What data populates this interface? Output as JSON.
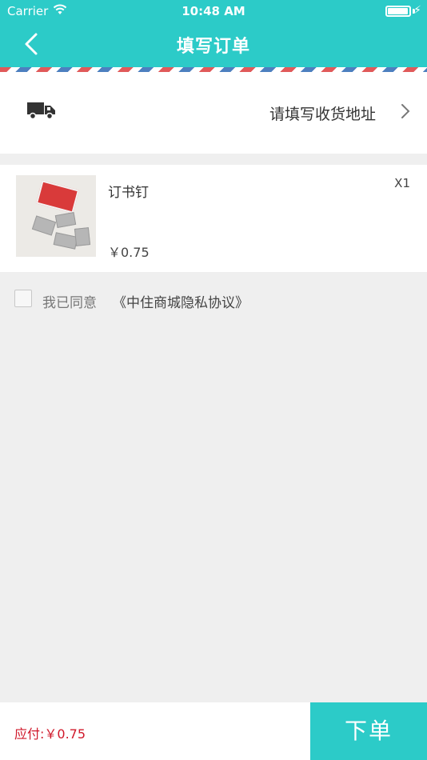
{
  "status_bar": {
    "carrier": "Carrier",
    "time": "10:48 AM",
    "battery_level": 0.95
  },
  "nav": {
    "title": "填写订单"
  },
  "address": {
    "placeholder": "请填写收货地址"
  },
  "product": {
    "name": "订书钉",
    "quantity": "X1",
    "price": "￥0.75"
  },
  "agreement": {
    "label": "我已同意",
    "link": "《中住商城隐私协议》",
    "checked": false
  },
  "footer": {
    "total": "应付:￥0.75",
    "order_button": "下单"
  },
  "colors": {
    "accent": "#2ccbc8",
    "price_red": "#d0182a",
    "background": "#efefef"
  }
}
